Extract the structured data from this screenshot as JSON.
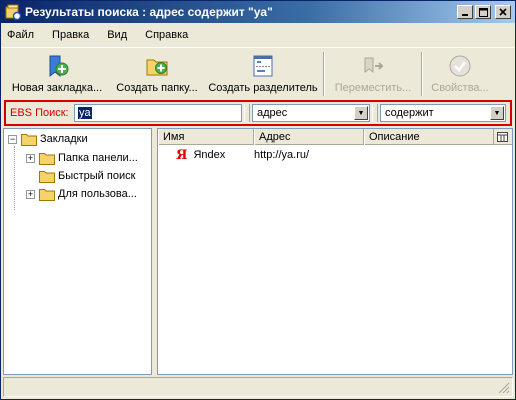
{
  "window": {
    "title": "Результаты поиска : адрес содержит \"ya\""
  },
  "menu": [
    {
      "label": "Файл"
    },
    {
      "label": "Правка"
    },
    {
      "label": "Вид"
    },
    {
      "label": "Справка"
    }
  ],
  "toolbar": {
    "new_bookmark": "Новая закладка...",
    "new_folder": "Создать папку...",
    "new_separator": "Создать разделитель",
    "move": "Переместить...",
    "properties": "Свойства..."
  },
  "search": {
    "label": "EBS Поиск:",
    "value": "ya",
    "field": "адрес",
    "condition": "содержит"
  },
  "tree": {
    "root": "Закладки",
    "items": [
      "Папка панели...",
      "Быстрый поиск",
      "Для пользова..."
    ]
  },
  "table": {
    "columns": [
      "Имя",
      "Адрес",
      "Описание"
    ],
    "rows": [
      {
        "name": "Яndex",
        "address": "http://ya.ru/",
        "description": ""
      }
    ]
  },
  "colors": {
    "accent": "#0a246a",
    "highlight": "#d40000"
  }
}
